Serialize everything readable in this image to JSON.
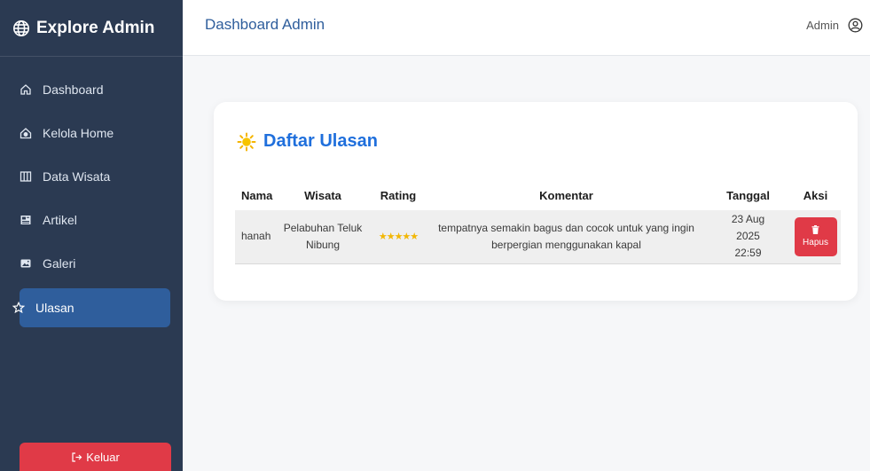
{
  "sidebar": {
    "brand": "Explore Admin",
    "items": [
      {
        "label": "Dashboard",
        "icon": "home-icon"
      },
      {
        "label": "Kelola Home",
        "icon": "home-gear-icon"
      },
      {
        "label": "Data Wisata",
        "icon": "map-icon"
      },
      {
        "label": "Artikel",
        "icon": "newspaper-icon"
      },
      {
        "label": "Galeri",
        "icon": "image-icon"
      },
      {
        "label": "Ulasan",
        "icon": "star-outline-icon",
        "active": true
      }
    ],
    "logout_label": "Keluar"
  },
  "header": {
    "title": "Dashboard Admin",
    "user": "Admin"
  },
  "reviews": {
    "title": "Daftar Ulasan",
    "columns": [
      "Nama",
      "Wisata",
      "Rating",
      "Komentar",
      "Tanggal",
      "Aksi"
    ],
    "rows": [
      {
        "nama": "hanah",
        "wisata": "Pelabuhan Teluk Nibung",
        "rating": 5,
        "rating_text": "★★★★★",
        "komentar": "tempatnya semakin bagus dan cocok untuk yang ingin berpergian menggunakan kapal",
        "tanggal": "23 Aug 2025 22:59",
        "action_label": "Hapus"
      }
    ]
  },
  "colors": {
    "sidebar_bg": "#2b3a52",
    "active_item": "#2f5e9c",
    "danger": "#e03a47",
    "title_blue": "#1f6fdc",
    "star": "#f2b705"
  }
}
